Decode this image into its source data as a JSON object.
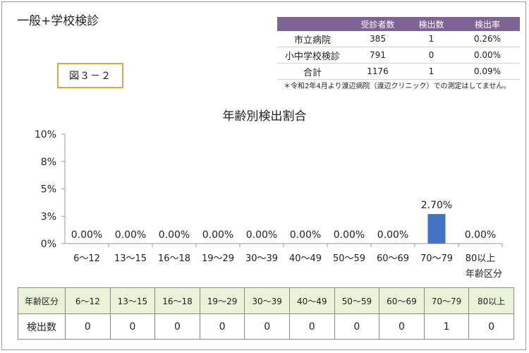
{
  "header": {
    "page_title": "一般+学校検診",
    "figure_label": "図３－２"
  },
  "summary": {
    "columns": [
      "",
      "受診者数",
      "検出数",
      "検出率"
    ],
    "rows": [
      {
        "name": "市立病院",
        "examinees": "385",
        "detected": "1",
        "rate": "0.26%"
      },
      {
        "name": "小中学校検診",
        "examinees": "791",
        "detected": "0",
        "rate": "0.00%"
      },
      {
        "name": "合計",
        "examinees": "1176",
        "detected": "1",
        "rate": "0.09%"
      }
    ],
    "note": "＊令和2年4月より渡辺病院（渡辺クリニック）での測定はしてません。"
  },
  "chart_data": {
    "type": "bar",
    "title": "年齢別検出割合",
    "xlabel": "年齢区分",
    "ylabel": "",
    "categories": [
      "6～12",
      "13～15",
      "16～18",
      "19～29",
      "30～39",
      "40～49",
      "50～59",
      "60～69",
      "70～79",
      "80以上"
    ],
    "values": [
      0.0,
      0.0,
      0.0,
      0.0,
      0.0,
      0.0,
      0.0,
      0.0,
      2.7,
      0.0
    ],
    "data_labels": [
      "0.00%",
      "0.00%",
      "0.00%",
      "0.00%",
      "0.00%",
      "0.00%",
      "0.00%",
      "0.00%",
      "2.70%",
      "0.00%"
    ],
    "ylim": [
      0,
      10
    ],
    "yticks": [
      0,
      2.5,
      5,
      7.5,
      10
    ],
    "ytick_labels": [
      "0%",
      "3%",
      "5%",
      "8%",
      "10%"
    ],
    "grid": false,
    "legend": "none",
    "bar_color": "#4472c4"
  },
  "age_table": {
    "header_label": "年齢区分",
    "count_label": "検出数",
    "groups": [
      "6～12",
      "13～15",
      "16～18",
      "19～29",
      "30～39",
      "40～49",
      "50～59",
      "60～69",
      "70～79",
      "80以上"
    ],
    "counts": [
      "0",
      "0",
      "0",
      "0",
      "0",
      "0",
      "0",
      "0",
      "1",
      "0"
    ]
  }
}
